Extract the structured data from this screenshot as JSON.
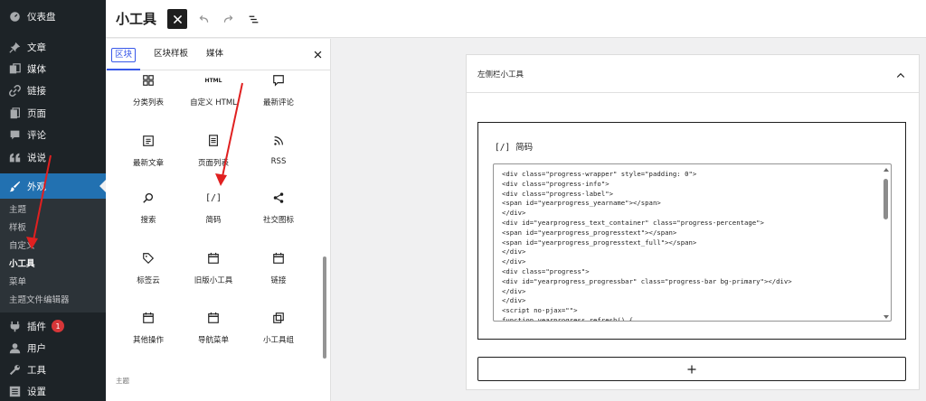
{
  "adminmenu": {
    "items": [
      {
        "label": "仪表盘",
        "icon": "dashboard-icon"
      },
      {
        "label": "文章",
        "icon": "pin-icon"
      },
      {
        "label": "媒体",
        "icon": "media-icon"
      },
      {
        "label": "链接",
        "icon": "link-icon"
      },
      {
        "label": "页面",
        "icon": "page-icon"
      },
      {
        "label": "评论",
        "icon": "comment-icon"
      },
      {
        "label": "说说",
        "icon": "quote-icon"
      },
      {
        "label": "外观",
        "icon": "brush-icon"
      },
      {
        "label": "插件",
        "icon": "plugin-icon",
        "badge": "1"
      },
      {
        "label": "用户",
        "icon": "user-icon"
      },
      {
        "label": "工具",
        "icon": "wrench-icon"
      },
      {
        "label": "设置",
        "icon": "settings-icon"
      }
    ],
    "submenu": [
      "主题",
      "样板",
      "自定义",
      "小工具",
      "菜单",
      "主题文件编辑器"
    ],
    "active_submenu": "小工具"
  },
  "header": {
    "title": "小工具"
  },
  "inserter": {
    "tabs": [
      "区块",
      "区块样板",
      "媒体"
    ],
    "active_tab": "区块",
    "blocks": [
      {
        "label": "分类列表",
        "icon": "grid-icon"
      },
      {
        "label": "自定义 HTML",
        "icon": "html-icon",
        "icon_text": "HTML"
      },
      {
        "label": "最新评论",
        "icon": "comment-icon"
      },
      {
        "label": "最新文章",
        "icon": "post-list-icon"
      },
      {
        "label": "页面列表",
        "icon": "pages-icon"
      },
      {
        "label": "RSS",
        "icon": "rss-icon"
      },
      {
        "label": "搜索",
        "icon": "search-icon"
      },
      {
        "label": "简码",
        "icon": "shortcode-icon",
        "icon_text": "[/]"
      },
      {
        "label": "社交图标",
        "icon": "share-icon"
      },
      {
        "label": "标签云",
        "icon": "tag-icon"
      },
      {
        "label": "旧版小工具",
        "icon": "calendar-icon"
      },
      {
        "label": "链接",
        "icon": "calendar-icon"
      },
      {
        "label": "其他操作",
        "icon": "calendar-icon"
      },
      {
        "label": "导航菜单",
        "icon": "calendar-icon"
      },
      {
        "label": "小工具组",
        "icon": "group-icon"
      }
    ],
    "section_label": "主题"
  },
  "widget_area": {
    "title": "左侧栏小工具",
    "shortcode_block": {
      "icon_text": "[/]",
      "label": "简码",
      "code": "<div class=\"progress-wrapper\" style=\"padding: 0\">\n<div class=\"progress-info\">\n<div class=\"progress-label\">\n<span id=\"yearprogress_yearname\"></span>\n</div>\n<div id=\"yearprogress_text_container\" class=\"progress-percentage\">\n<span id=\"yearprogress_progresstext\"></span>\n<span id=\"yearprogress_progresstext_full\"></span>\n</div>\n</div>\n<div class=\"progress\">\n<div id=\"yearprogress_progressbar\" class=\"progress-bar bg-primary\"></div>\n</div>\n</div>\n<script no-pjax=\"\">\nfunction yearprogress_refresh() {"
    },
    "add_block_label": "+"
  },
  "colors": {
    "sidebar_bg": "#1d2327",
    "accent": "#2271b1",
    "tab_accent": "#3858e9",
    "badge": "#d63638",
    "arrow": "#e02020"
  }
}
